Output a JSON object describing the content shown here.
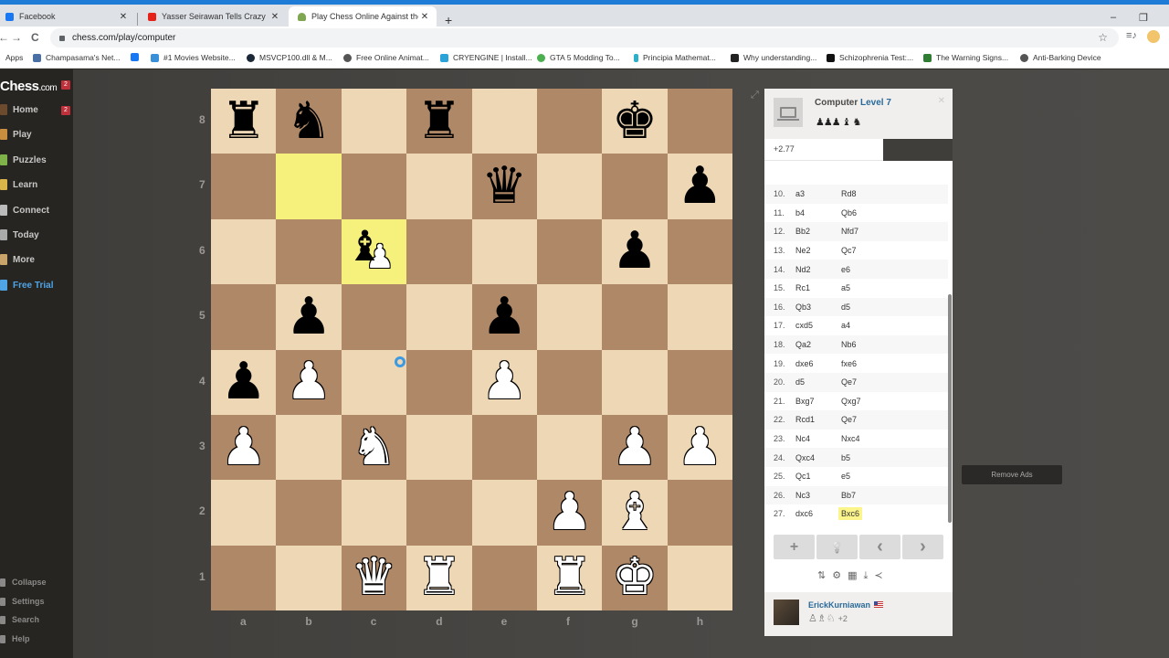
{
  "browser": {
    "tabs": [
      {
        "label": "Facebook",
        "icon": "facebook-icon",
        "color": "#1877f2",
        "active": false
      },
      {
        "label": "Yasser Seirawan Tells Crazy Bobb",
        "icon": "youtube-icon",
        "color": "#e62117",
        "active": false
      },
      {
        "label": "Play Chess Online Against the Co",
        "icon": "chess-pawn-icon",
        "color": "#7fa650",
        "active": true
      }
    ],
    "new_tab": "+",
    "minimize": "–",
    "restore": "❐",
    "url": "chess.com/play/computer",
    "back": "←",
    "forward": "→",
    "reload": "C",
    "bookmark_star": "☆",
    "reading_list": "≡♪",
    "bookmarks": [
      {
        "label": "Apps",
        "color": null
      },
      {
        "label": "Champasama's Net...",
        "color": "#4a6fa5"
      },
      {
        "label": "",
        "color": "#1877f2"
      },
      {
        "label": "#1 Movies Website...",
        "color": "#3a8fd9"
      },
      {
        "label": "MSVCP100.dll & M...",
        "color": "#1b2838"
      },
      {
        "label": "Free Online Animat...",
        "color": "#555"
      },
      {
        "label": "CRYENGINE | Install...",
        "color": "#2aa3d8"
      },
      {
        "label": "GTA 5 Modding To...",
        "color": "#4caf50"
      },
      {
        "label": "Principia Mathemat...",
        "color": "#2ab0c8"
      },
      {
        "label": "Why understanding...",
        "color": "#222"
      },
      {
        "label": "Schizophrenia Test:...",
        "color": "#111"
      },
      {
        "label": "The Warning Signs...",
        "color": "#2e7d32"
      },
      {
        "label": "Anti-Barking Device",
        "color": "#555"
      }
    ]
  },
  "sidebar": {
    "logo": "Chess",
    "logo_suffix": ".com",
    "logo_badge": "2",
    "items": [
      {
        "label": "Home",
        "badge": "2",
        "color": "#6b4a2e"
      },
      {
        "label": "Play",
        "badge": null,
        "color": "#c98e3e"
      },
      {
        "label": "Puzzles",
        "badge": null,
        "color": "#7fb34a"
      },
      {
        "label": "Learn",
        "badge": null,
        "color": "#d9b54a"
      },
      {
        "label": "Connect",
        "badge": null,
        "color": "#bbb"
      },
      {
        "label": "Today",
        "badge": null,
        "color": "#aaa"
      },
      {
        "label": "More",
        "badge": null,
        "color": "#c9a46a"
      },
      {
        "label": "Free Trial",
        "badge": null,
        "color": "#4fa4e6"
      }
    ],
    "bottom": [
      "Collapse",
      "Settings",
      "Search",
      "Help"
    ]
  },
  "board": {
    "ranks": [
      "8",
      "7",
      "6",
      "5",
      "4",
      "3",
      "2",
      "1"
    ],
    "files": [
      "a",
      "b",
      "c",
      "d",
      "e",
      "f",
      "g",
      "h"
    ],
    "highlighted": [
      "b7",
      "c6"
    ],
    "position": {
      "a8": "bR",
      "b8": "bN",
      "d8": "bR",
      "g8": "bK",
      "e7": "bQ",
      "h7": "bP",
      "c6": "bB",
      "g6": "bP",
      "b5": "bP",
      "e5": "bP",
      "a4": "bP",
      "b4": "wP",
      "e4": "wP",
      "a3": "wP",
      "c3": "wN",
      "g3": "wP",
      "h3": "wP",
      "f2": "wP",
      "g2": "wB",
      "c1": "wQ",
      "d1": "wR",
      "f1": "wR",
      "g1": "wK"
    },
    "captured_under": {
      "c6": "wP"
    }
  },
  "panel": {
    "opponent_name": "Computer",
    "opponent_level": "Level 7",
    "opponent_captured": "♟♟♟ ♝ ♞",
    "evaluation": "+2.77",
    "evaluation_white_fraction": 0.63,
    "moves": [
      {
        "n": "10.",
        "w": "a3",
        "b": "Rd8"
      },
      {
        "n": "11.",
        "w": "b4",
        "b": "Qb6"
      },
      {
        "n": "12.",
        "w": "Bb2",
        "b": "Nfd7"
      },
      {
        "n": "13.",
        "w": "Ne2",
        "b": "Qc7"
      },
      {
        "n": "14.",
        "w": "Nd2",
        "b": "e6"
      },
      {
        "n": "15.",
        "w": "Rc1",
        "b": "a5"
      },
      {
        "n": "16.",
        "w": "Qb3",
        "b": "d5"
      },
      {
        "n": "17.",
        "w": "cxd5",
        "b": "a4"
      },
      {
        "n": "18.",
        "w": "Qa2",
        "b": "Nb6"
      },
      {
        "n": "19.",
        "w": "dxe6",
        "b": "fxe6"
      },
      {
        "n": "20.",
        "w": "d5",
        "b": "Qe7"
      },
      {
        "n": "21.",
        "w": "Bxg7",
        "b": "Qxg7"
      },
      {
        "n": "22.",
        "w": "Rcd1",
        "b": "Qe7"
      },
      {
        "n": "23.",
        "w": "Nc4",
        "b": "Nxc4"
      },
      {
        "n": "24.",
        "w": "Qxc4",
        "b": "b5"
      },
      {
        "n": "25.",
        "w": "Qc1",
        "b": "e5"
      },
      {
        "n": "26.",
        "w": "Nc3",
        "b": "Bb7"
      },
      {
        "n": "27.",
        "w": "dxc6",
        "b": "Bxc6"
      }
    ],
    "current_move_index": 17,
    "controls": {
      "new": "+",
      "hint": "💡",
      "prev": "‹",
      "next": "›"
    },
    "tools": {
      "flip": "⇅",
      "settings": "⚙",
      "analysis": "▦",
      "download": "⤓",
      "share": "≺"
    },
    "player_name": "ErickKurniawan",
    "player_captured": "♙♗♘",
    "player_captured_extra": "+2"
  },
  "ads": {
    "remove_label": "Remove Ads"
  }
}
